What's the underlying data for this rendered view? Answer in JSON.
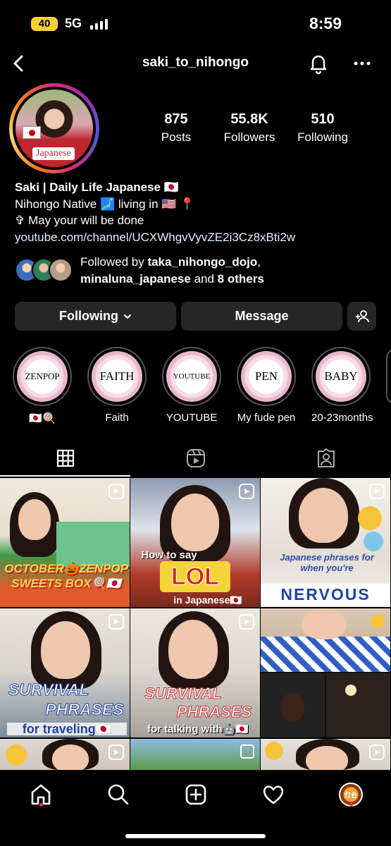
{
  "status_bar": {
    "battery": "40",
    "network": "5G",
    "time": "8:59"
  },
  "header": {
    "username": "saki_to_nihongo"
  },
  "profile": {
    "avatar_tag": "Japanese",
    "stats": [
      {
        "value": "875",
        "label": "Posts"
      },
      {
        "value": "55.8K",
        "label": "Followers"
      },
      {
        "value": "510",
        "label": "Following"
      }
    ],
    "name": "Saki | Daily Life Japanese 🇯🇵",
    "bio_line1": "Nihongo Native 🗾 living in 🇺🇸 📍",
    "bio_line2": "✞ May your will be done",
    "link": "youtube.com/channel/UCXWhgvVyvZE2i3Cz8xBti2w",
    "followed_by_prefix": "Followed by ",
    "followed_by_user1": "taka_nihongo_dojo",
    "followed_by_sep": ",",
    "followed_by_user2": "minaluna_japanese",
    "followed_by_and": " and ",
    "followed_by_others": "8 others"
  },
  "actions": {
    "following_label": "Following",
    "message_label": "Message"
  },
  "highlights": [
    {
      "cover": "ZENPOP",
      "label": "🇯🇵🍭"
    },
    {
      "cover": "FAITH",
      "label": "Faith"
    },
    {
      "cover": "YOUTUBE",
      "label": "YOUTUBE"
    },
    {
      "cover": "PEN",
      "label": "My fude pen"
    },
    {
      "cover": "BABY",
      "label": "20-23months"
    }
  ],
  "posts": [
    {
      "line1": "OCTOBER🎃ZENPOP",
      "line2": "SWEETS BOX🍭🇯🇵"
    },
    {
      "line1": "How to say",
      "line2": "LOL",
      "line3": "in Japanese🇯🇵"
    },
    {
      "line1": "Japanese phrases for",
      "line2": "when you're",
      "line3": "NERVOUS"
    },
    {
      "line1": "SURVIVAL",
      "line2": "PHRASES",
      "line3": "for traveling🇯🇵"
    },
    {
      "line1": "SURVIVAL",
      "line2": "PHRASES",
      "line3": "for talking with🤖🇯🇵"
    },
    {
      "line1": ""
    }
  ],
  "bottom_nav": {
    "profile_avatar_text": "灯台"
  },
  "colors": {
    "background": "#000000",
    "button": "#262626",
    "notification_dot": "#ff3040",
    "battery": "#f5d033"
  }
}
